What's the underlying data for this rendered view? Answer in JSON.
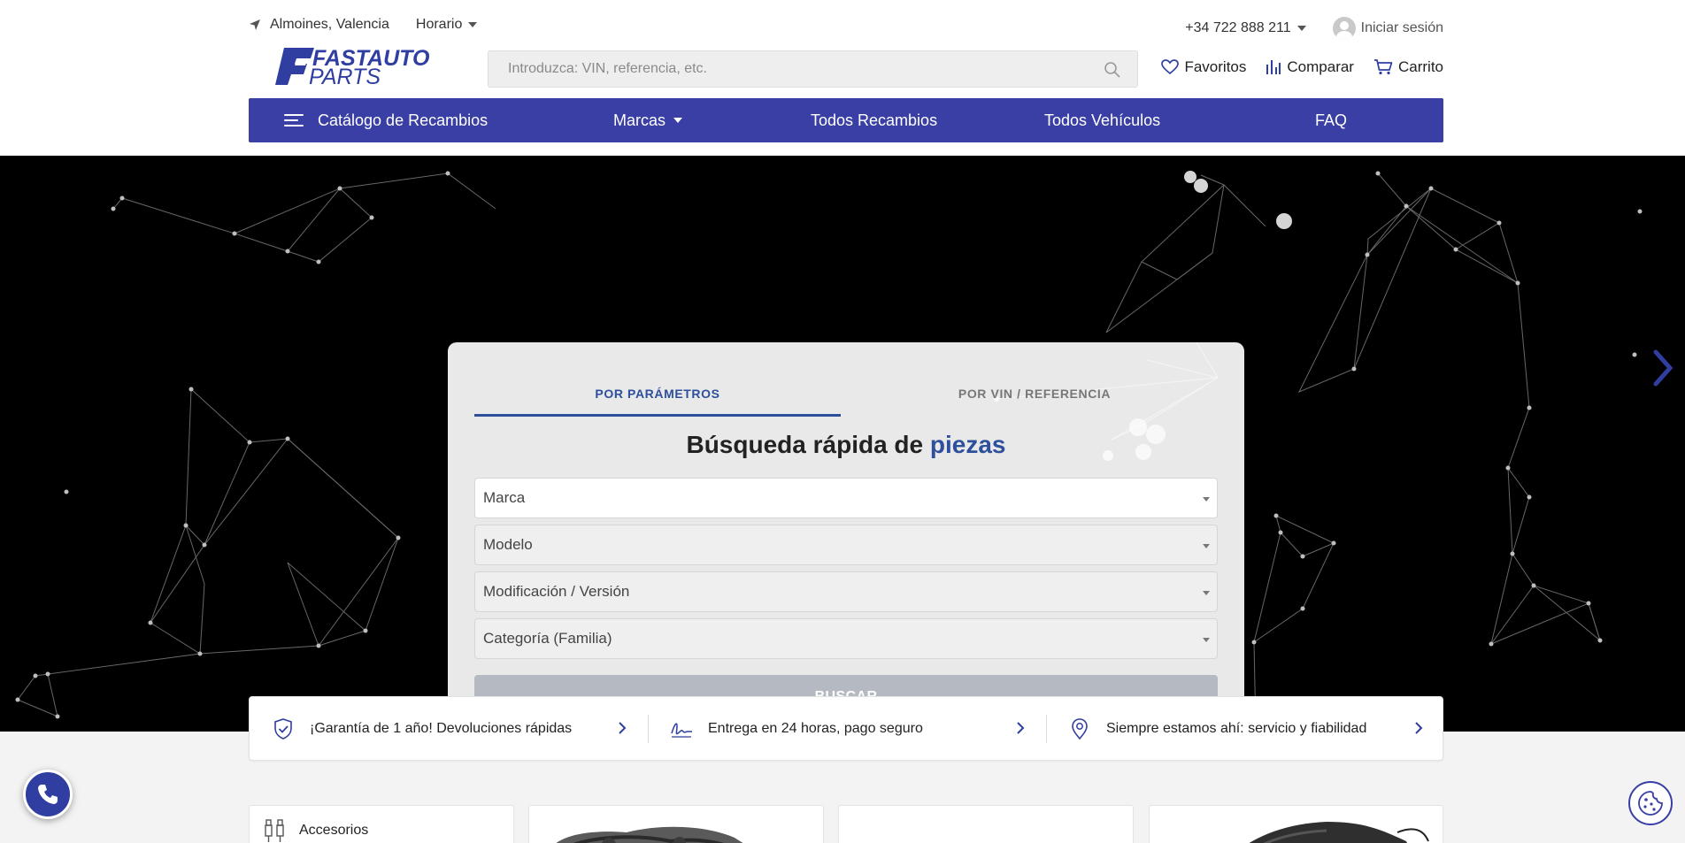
{
  "topbar": {
    "location": "Almoines, Valencia",
    "hours_label": "Horario",
    "phone": "+34 722 888 211",
    "login_label": "Iniciar sesión"
  },
  "logo": {
    "line1": "FASTAUTO",
    "line2": "PARTS",
    "icon": "f-logo-icon"
  },
  "search": {
    "placeholder": "Introduzca: VIN, referencia, etc.",
    "value": ""
  },
  "actions": {
    "favorites": "Favoritos",
    "compare": "Comparar",
    "cart": "Carrito"
  },
  "nav": {
    "catalog": "Catálogo de Recambios",
    "brands": "Marcas",
    "all_parts": "Todos Recambios",
    "all_vehicles": "Todos Vehículos",
    "faq": "FAQ"
  },
  "finder": {
    "tab_params": "POR PARÁMETROS",
    "tab_vin": "POR VIN / REFERENCIA",
    "title_prefix": "Búsqueda rápida de ",
    "title_highlight": "piezas",
    "fields": [
      "Marca",
      "Modelo",
      "Modificación / Versión",
      "Categoría (Familia)"
    ],
    "submit": "BUSCAR"
  },
  "features": [
    {
      "text": "¡Garantía de 1 año! Devoluciones rápidas",
      "icon": "shield-check-icon"
    },
    {
      "text": "Entrega en 24 horas, pago seguro",
      "icon": "signature-icon"
    },
    {
      "text": "Siempre estamos ahí: servicio y fiabilidad",
      "icon": "location-pin-icon"
    }
  ],
  "categories": [
    {
      "label": "Accesorios",
      "icon": "spark-plug-icon"
    }
  ],
  "colors": {
    "brand_blue": "#3a3fa5",
    "accent_blue": "#2e4f9c",
    "button_disabled": "#b5b9c2"
  }
}
